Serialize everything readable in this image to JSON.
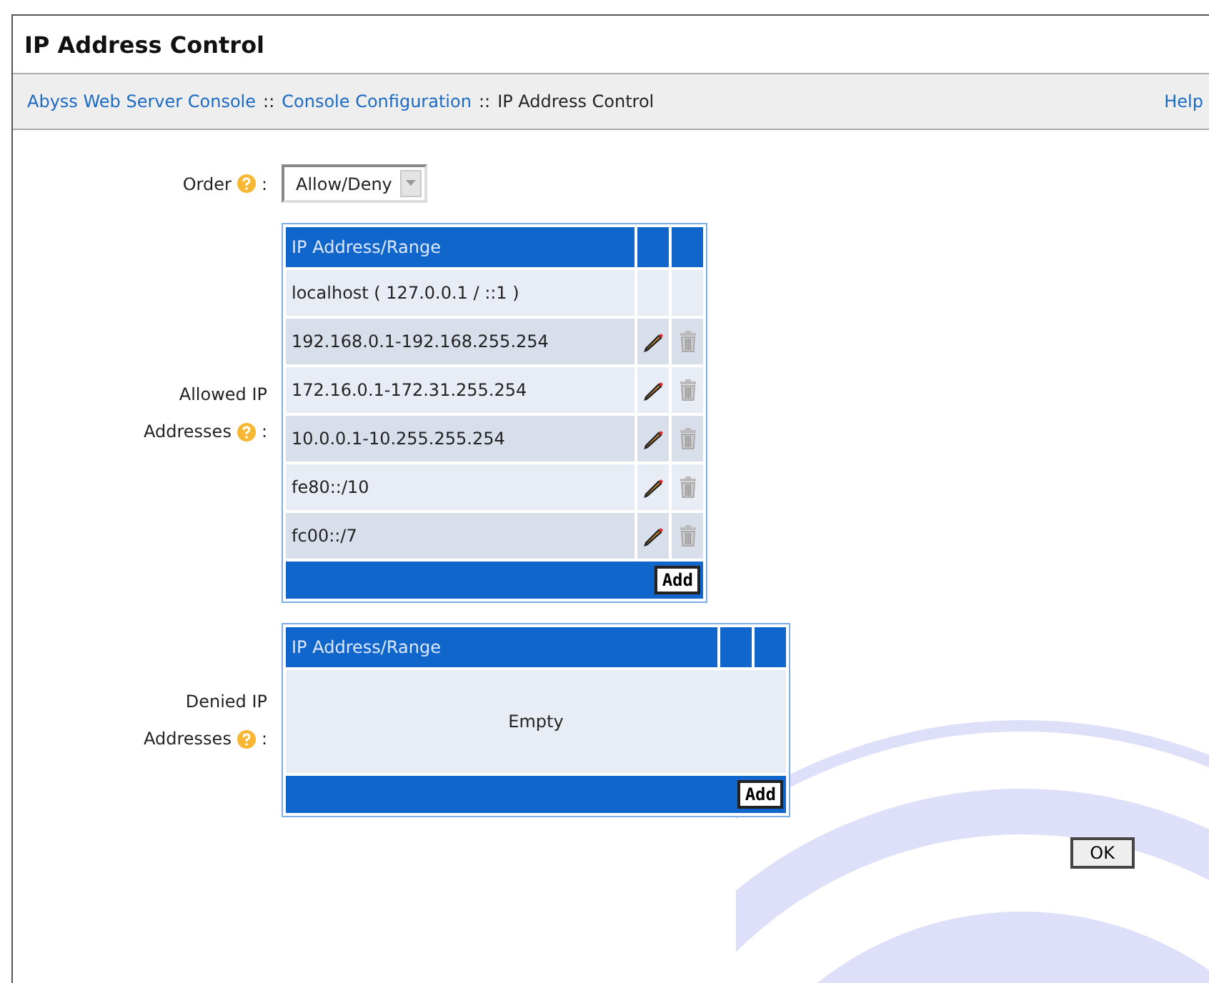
{
  "page": {
    "title": "IP Address Control"
  },
  "breadcrumb": {
    "items": [
      {
        "label": "Abyss Web Server Console",
        "kind": "link"
      },
      {
        "label": "::",
        "kind": "separator"
      },
      {
        "label": "Console Configuration",
        "kind": "link"
      },
      {
        "label": "::",
        "kind": "separator"
      },
      {
        "label": "IP Address Control",
        "kind": "current"
      }
    ],
    "help": "Help"
  },
  "order": {
    "label": "Order",
    "colon": ":",
    "value": "Allow/Deny"
  },
  "allowed": {
    "label_lines": [
      "Allowed IP",
      "Addresses"
    ],
    "colon": ":",
    "column": "IP Address/Range",
    "add": "Add",
    "rows": [
      {
        "address": "localhost ( 127.0.0.1 / ::1 )",
        "kind": "fixed"
      },
      {
        "address": "192.168.0.1-192.168.255.254",
        "kind": "editable"
      },
      {
        "address": "172.16.0.1-172.31.255.254",
        "kind": "editable"
      },
      {
        "address": "10.0.0.1-10.255.255.254",
        "kind": "editable"
      },
      {
        "address": "fe80::/10",
        "kind": "editable"
      },
      {
        "address": "fc00::/7",
        "kind": "editable"
      }
    ]
  },
  "denied": {
    "label_lines": [
      "Denied IP",
      "Addresses"
    ],
    "colon": ":",
    "column": "IP Address/Range",
    "add": "Add",
    "empty": "Empty"
  },
  "ok": "OK"
}
